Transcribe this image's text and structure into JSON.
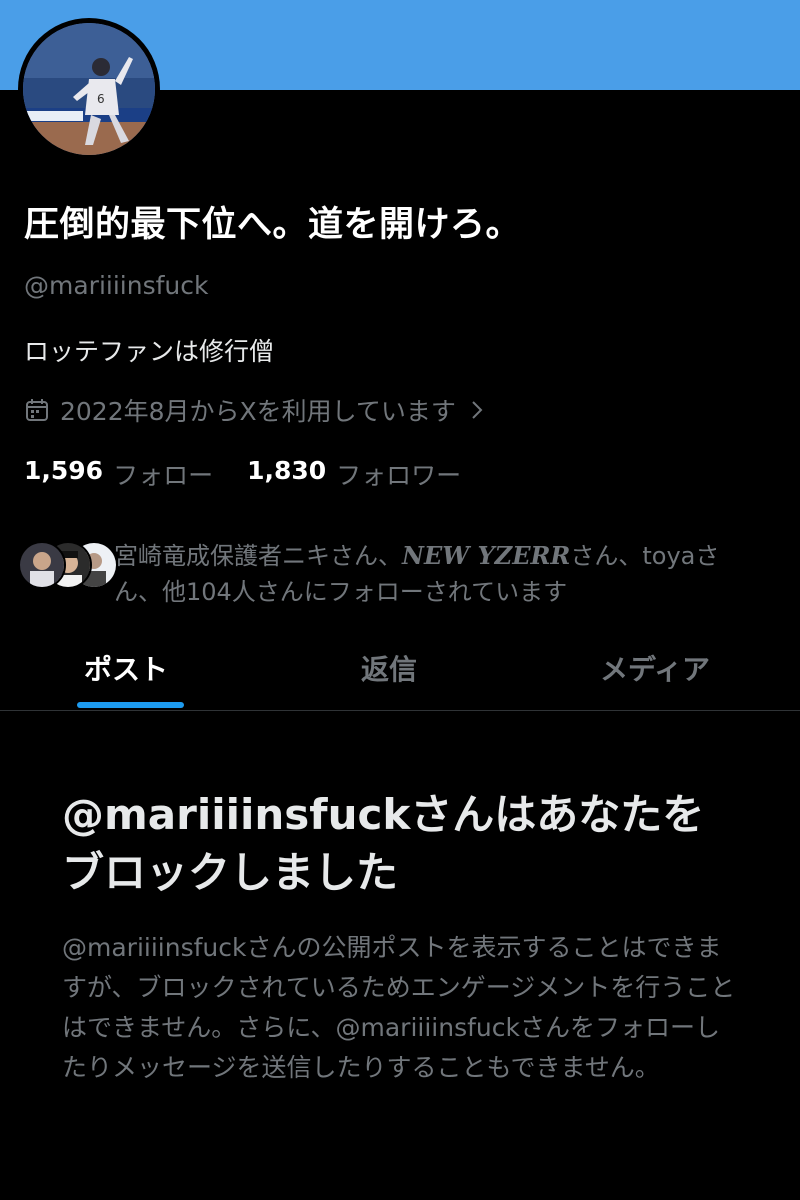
{
  "profile": {
    "display_name": "圧倒的最下位へ。道を開けろ。",
    "handle": "@mariiiinsfuck",
    "bio": "ロッテファンは修行僧",
    "joined": "2022年8月からXを利用しています",
    "avatar_icon": "baseball-player-photo",
    "banner_color": "#4a9ee8"
  },
  "stats": {
    "following_count": "1,596",
    "following_label": "フォロー",
    "followers_count": "1,830",
    "followers_label": "フォロワー"
  },
  "followed_by": {
    "name_1": "宮崎竜成保護者ニキ",
    "sep_1": "さん、",
    "name_2": "NEW YZERR",
    "sep_2": "さん、",
    "name_3": "toya",
    "suffix": "さん、他104人さんにフォローされています"
  },
  "tabs": [
    {
      "label": "ポスト"
    },
    {
      "label": "返信"
    },
    {
      "label": "メディア"
    }
  ],
  "blocked": {
    "title": "@mariiiinsfuckさんはあなたをブロックしました",
    "body": "@mariiiinsfuckさんの公開ポストを表示することはできますが、ブロックされているためエンゲージメントを行うことはできません。さらに、@mariiiinsfuckさんをフォローしたりメッセージを送信したりすることもできません。"
  },
  "colors": {
    "accent": "#1d9bf0",
    "muted_text": "#71767b",
    "background": "#000000"
  }
}
